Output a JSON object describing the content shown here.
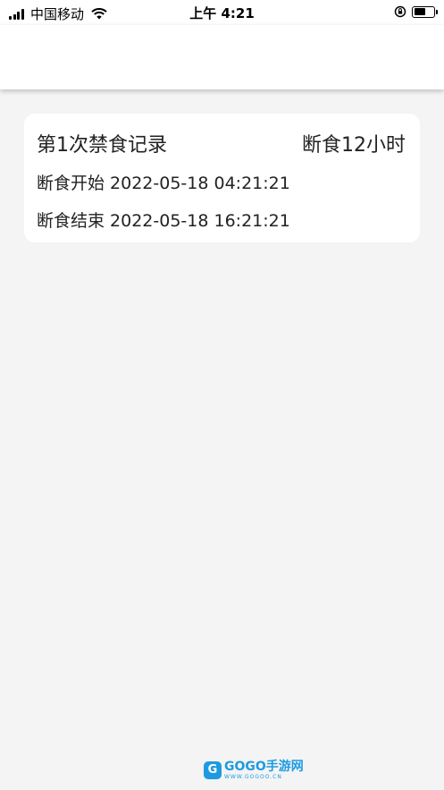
{
  "status_bar": {
    "carrier": "中国移动",
    "time": "上午 4:21",
    "battery_level": 0.6,
    "icons": [
      "signal-icon",
      "wifi-icon",
      "orientation-lock-icon",
      "battery-icon"
    ]
  },
  "record": {
    "title": "第1次禁食记录",
    "duration": "断食12小时",
    "start_line": "断食开始 2022-05-18 04:21:21",
    "end_line": "断食结束 2022-05-18 16:21:21"
  },
  "watermark": {
    "main": "GOGO手游网",
    "sub": "WWW.GOGOO.CN"
  },
  "colors": {
    "background": "#f4f4f4",
    "card": "#ffffff",
    "watermark": "#1e9be0"
  }
}
